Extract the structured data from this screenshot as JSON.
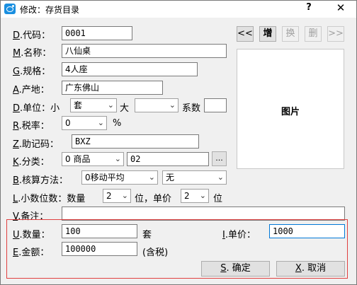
{
  "window": {
    "title": "修改：存货目录",
    "help_label": "?",
    "close_label": "✕"
  },
  "form": {
    "code": {
      "key": "D",
      "label": ".代码：",
      "value": "0001"
    },
    "name": {
      "key": "M",
      "label": ".名称：",
      "value": "八仙桌"
    },
    "spec": {
      "key": "G",
      "label": ".规格：",
      "value": "4人座"
    },
    "origin": {
      "key": "A",
      "label": ".产地：",
      "value": "广东佛山"
    },
    "unit": {
      "key": "D",
      "label": ".单位：小",
      "small_value": "套",
      "big_label": "大",
      "big_value": "",
      "factor_label": "系数",
      "factor_value": ""
    },
    "tax": {
      "key": "R",
      "label": ".税率：",
      "value": "0",
      "unit": "%"
    },
    "mnemonic": {
      "key": "Z",
      "label": ".助记码：",
      "value": "BXZ"
    },
    "category": {
      "key": "K",
      "label": ".分类：",
      "value": "0 商品",
      "code": "02",
      "more_label": "..."
    },
    "costing": {
      "key": "B",
      "label": ".核算方法：",
      "method": "0移动平均",
      "option": "无"
    },
    "decimals": {
      "key": "L",
      "label": ".小数位数：数量",
      "qty_value": "2",
      "mid_label": "位，单价",
      "price_value": "2",
      "end_label": "位"
    },
    "remark": {
      "key": "V",
      "label": ".备注：",
      "value": ""
    },
    "quantity": {
      "key": "U",
      "label": ".数量：",
      "value": "100",
      "unit": "套"
    },
    "unit_price": {
      "key": "I",
      "label": ".单价：",
      "value": "1000"
    },
    "amount": {
      "key": "E",
      "label": ".金额：",
      "value": "100000",
      "note": "(含税)"
    }
  },
  "nav_buttons": {
    "prev": "<<",
    "add": "增",
    "swap": "换",
    "delete": "删",
    "next": ">>"
  },
  "picture_label": "图片",
  "actions": {
    "ok": {
      "key": "S",
      "label": ". 确定"
    },
    "cancel": {
      "key": "X",
      "label": ". 取消"
    }
  }
}
